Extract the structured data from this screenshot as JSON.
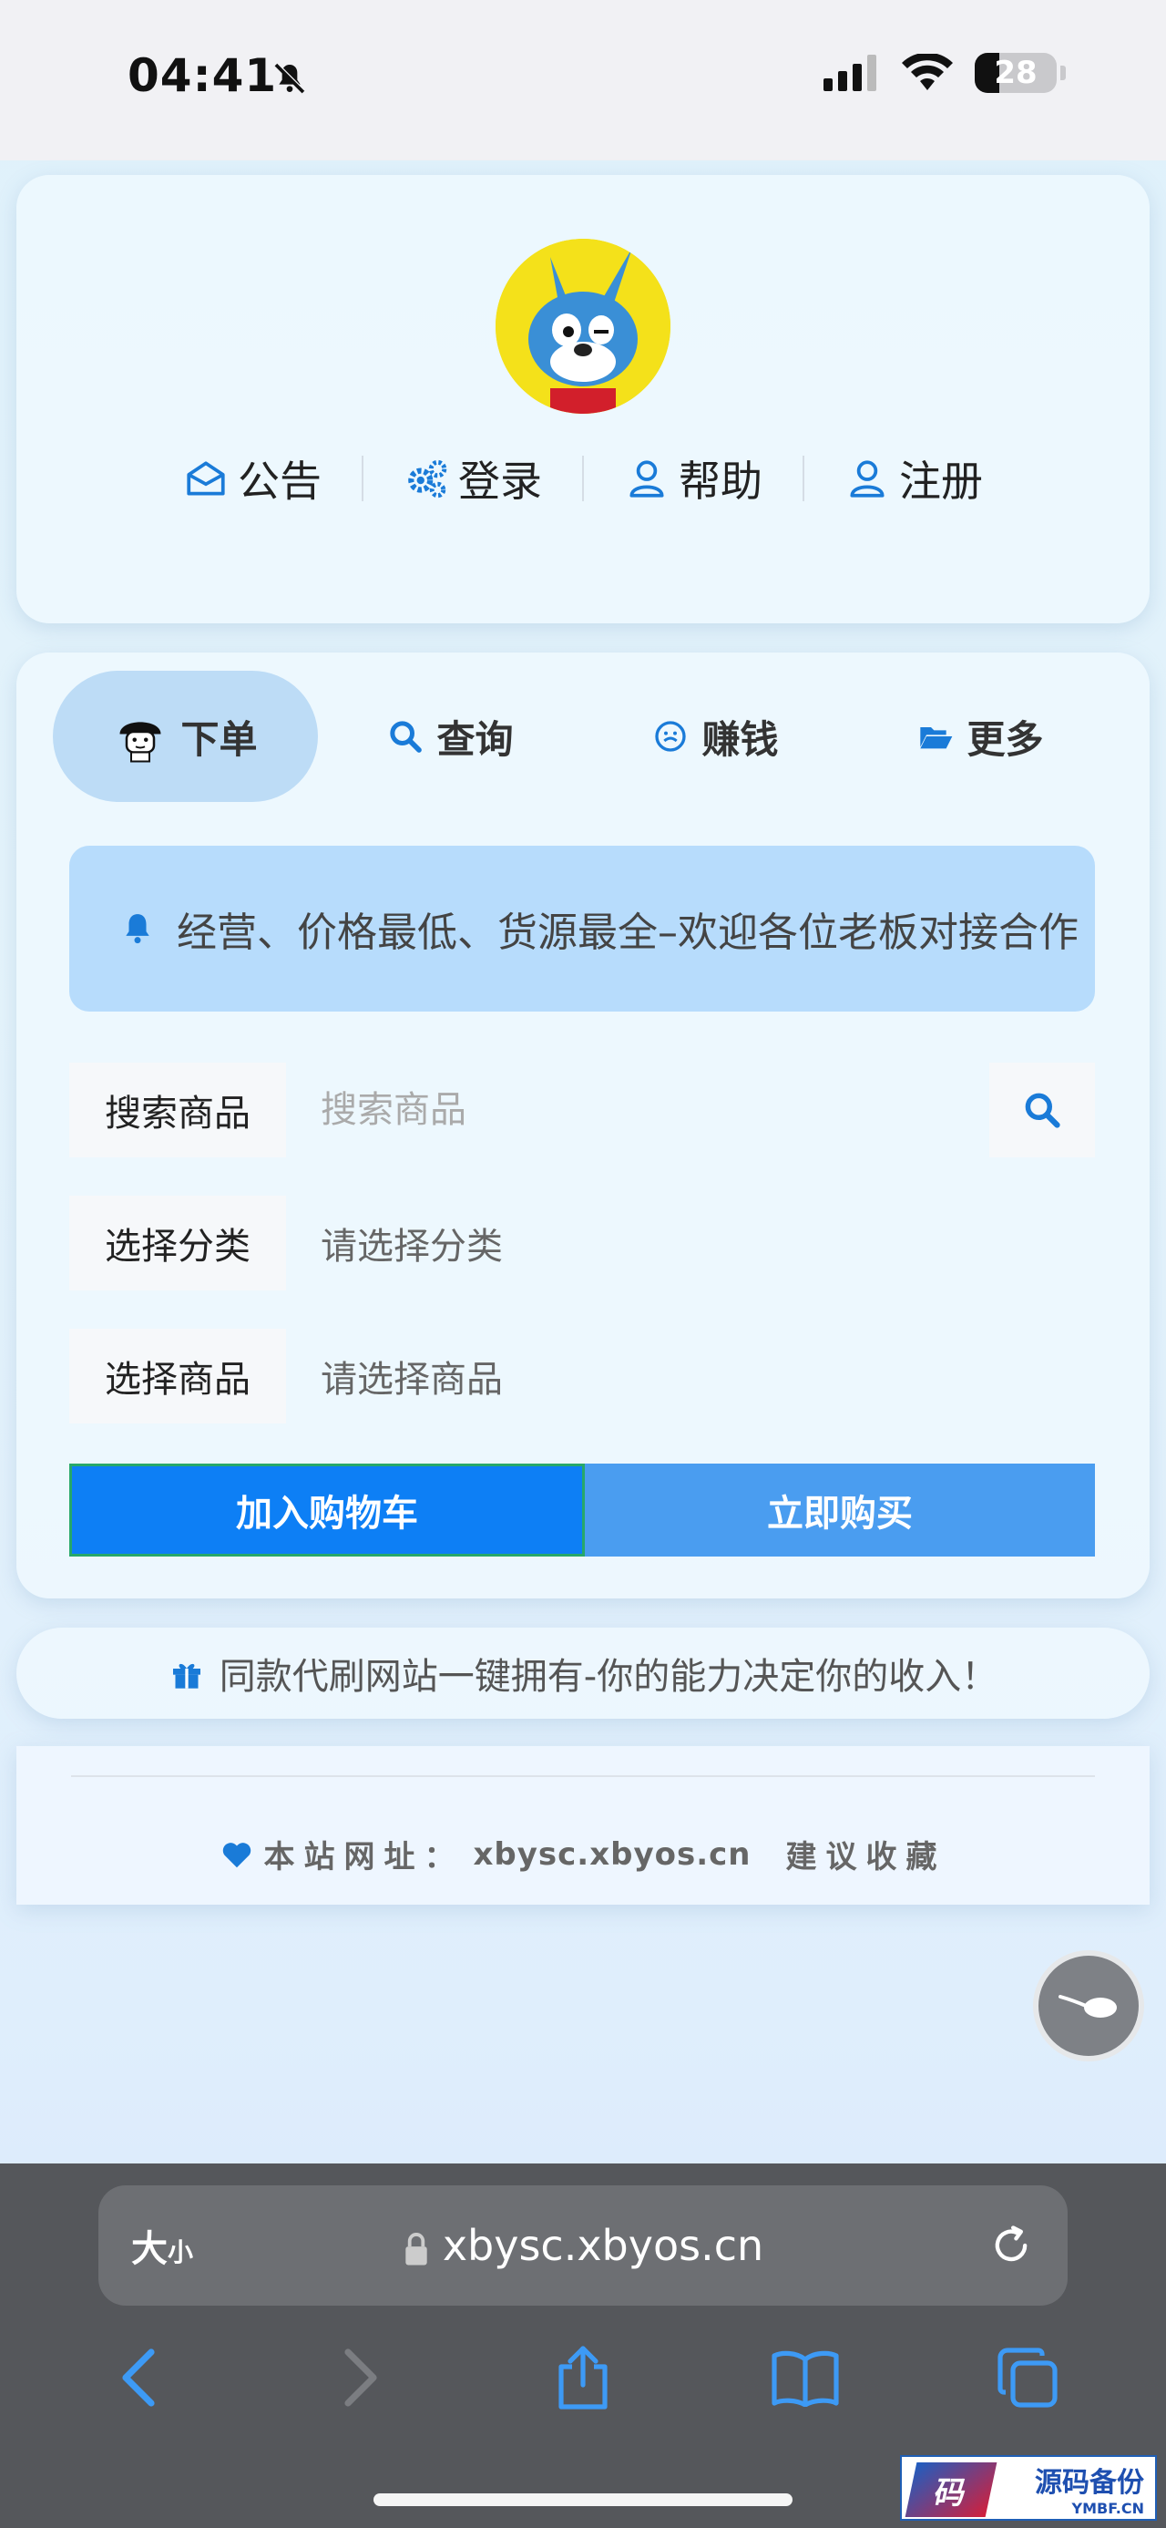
{
  "status_bar": {
    "time": "04:41",
    "battery": "28"
  },
  "top_nav": [
    {
      "label": "公告",
      "icon": "envelope-open-icon"
    },
    {
      "label": "登录",
      "icon": "gears-icon"
    },
    {
      "label": "帮助",
      "icon": "user-icon"
    },
    {
      "label": "注册",
      "icon": "user-icon"
    }
  ],
  "tabs": [
    {
      "label": "下单",
      "icon": "mushroom-avatar-icon",
      "active": true
    },
    {
      "label": "查询",
      "icon": "search-icon",
      "active": false
    },
    {
      "label": "赚钱",
      "icon": "smile-circle-icon",
      "active": false
    },
    {
      "label": "更多",
      "icon": "folder-open-icon",
      "active": false
    }
  ],
  "notice": {
    "text": "经营、价格最低、货源最全–欢迎各位老板对接合作"
  },
  "form": {
    "search_label": "搜索商品",
    "search_placeholder": "搜索商品",
    "category_label": "选择分类",
    "category_value": "请选择分类",
    "product_label": "选择商品",
    "product_value": "请选择商品"
  },
  "buttons": {
    "add_cart": "加入购物车",
    "buy_now": "立即购买"
  },
  "promo": {
    "text": "同款代刷网站一键拥有-你的能力决定你的收入！"
  },
  "footer": {
    "label": "本站网址：",
    "domain": "xbysc.xbyos.cn",
    "suggest": "建议收藏"
  },
  "browser": {
    "text_size_big": "大",
    "text_size_small": "小",
    "url": "xbysc.xbyos.cn"
  },
  "watermark": {
    "badge": "码",
    "title": "源码备份",
    "sub": "YMBF.CN"
  },
  "colors": {
    "accent": "#0d7ff5",
    "buy_button": "#4a9df0",
    "notice_bg": "#b7dcfc",
    "active_tab": "#bddcf6"
  }
}
